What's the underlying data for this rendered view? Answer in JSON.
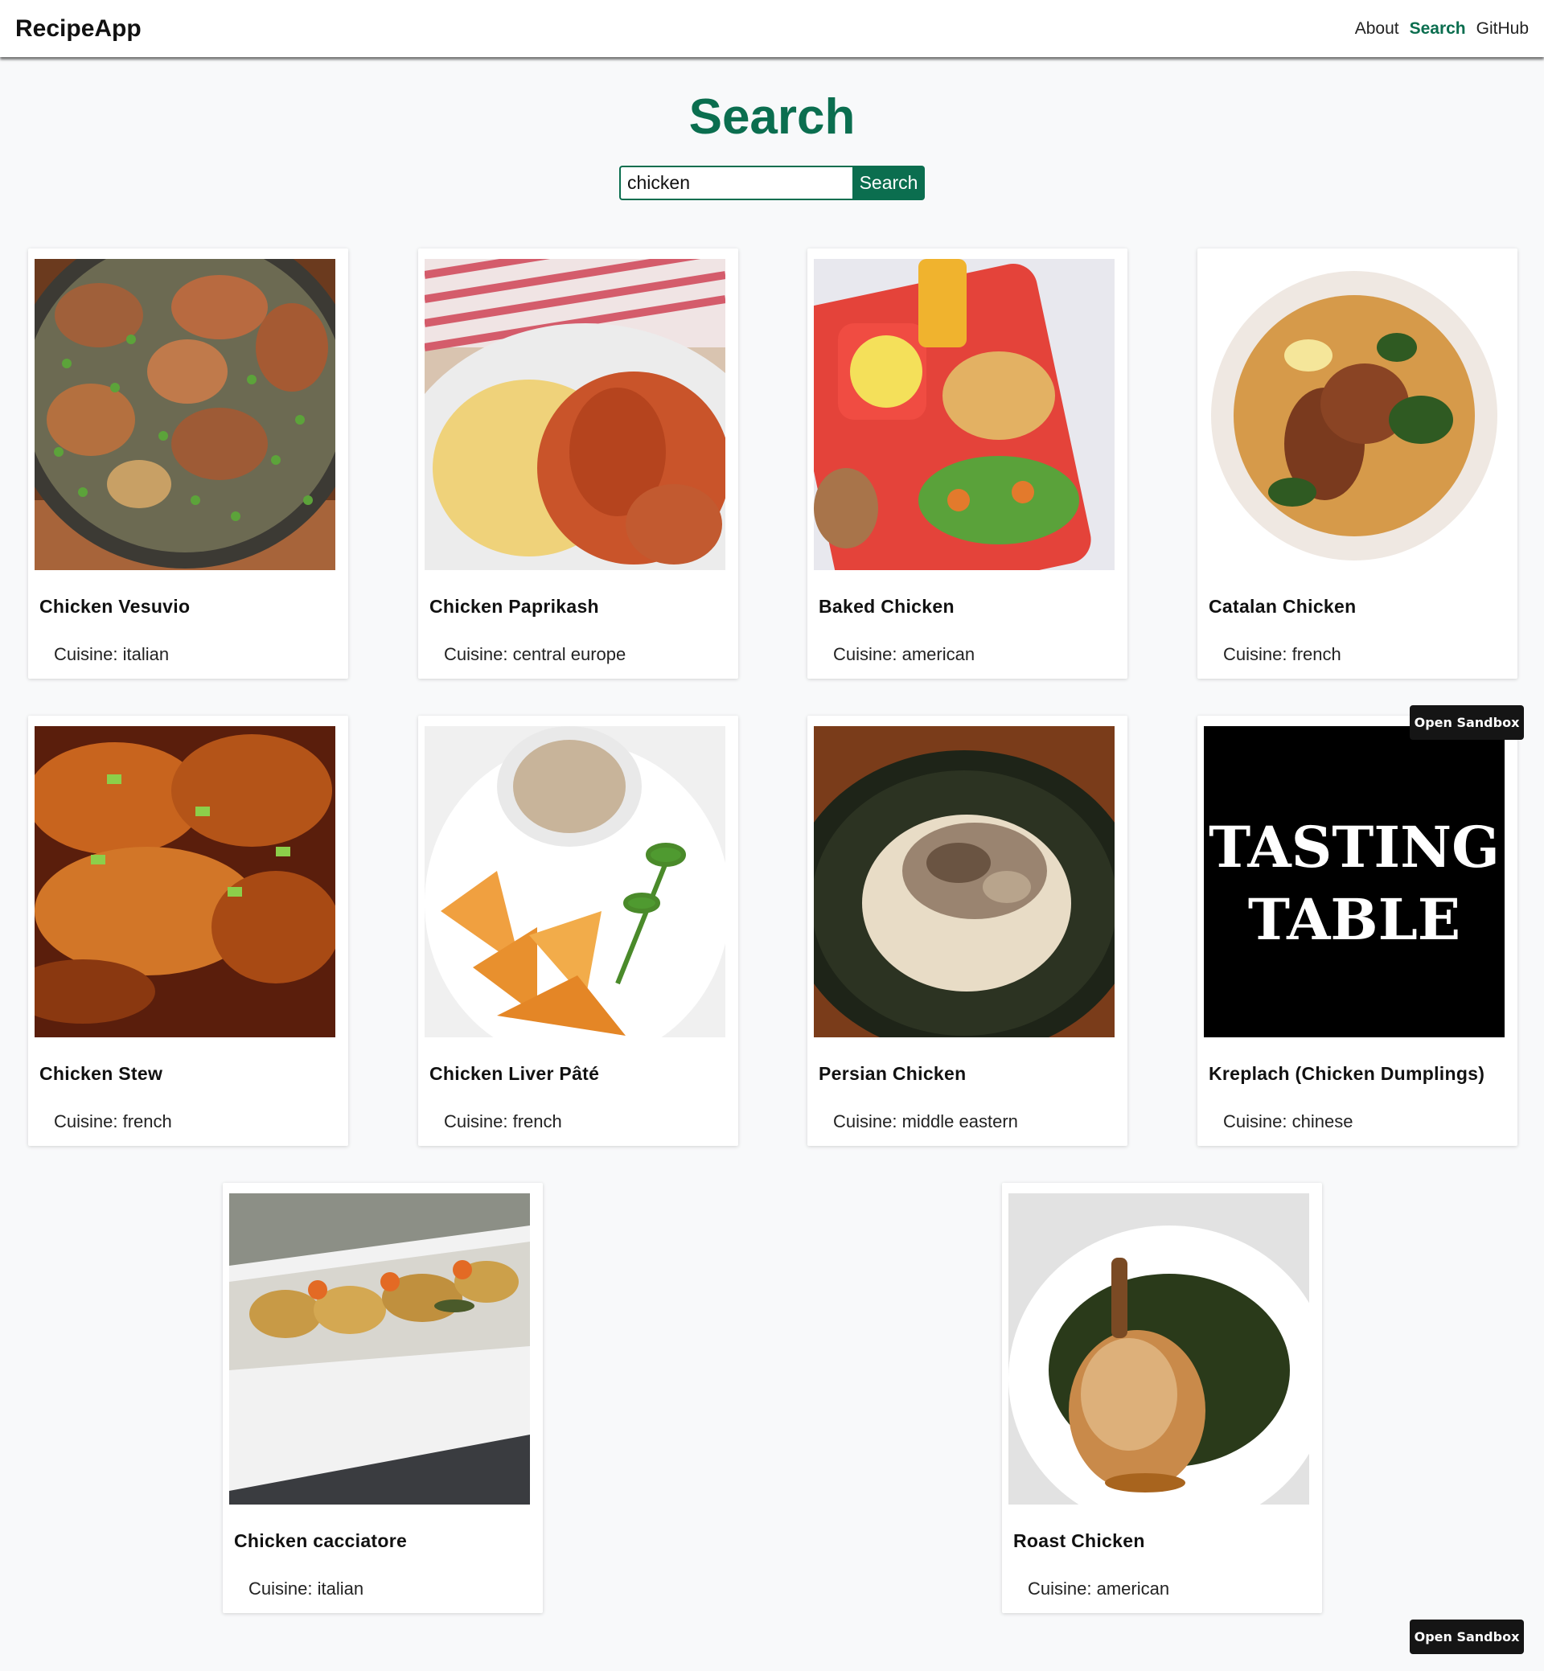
{
  "navbar": {
    "brand": "RecipeApp",
    "links": [
      {
        "label": "About",
        "active": false
      },
      {
        "label": "Search",
        "active": true
      },
      {
        "label": "GitHub",
        "active": false
      }
    ]
  },
  "page": {
    "title": "Search"
  },
  "search": {
    "value": "chicken",
    "button_label": "Search"
  },
  "recipes": [
    {
      "title": "Chicken Vesuvio",
      "cuisine": "Cuisine: italian"
    },
    {
      "title": "Chicken Paprikash",
      "cuisine": "Cuisine: central europe"
    },
    {
      "title": "Baked Chicken",
      "cuisine": "Cuisine: american"
    },
    {
      "title": "Catalan Chicken",
      "cuisine": "Cuisine: french"
    },
    {
      "title": "Chicken Stew",
      "cuisine": "Cuisine: french"
    },
    {
      "title": "Chicken Liver Pâté",
      "cuisine": "Cuisine: french"
    },
    {
      "title": "Persian Chicken",
      "cuisine": "Cuisine: middle eastern"
    },
    {
      "title": "Kreplach (Chicken Dumplings)",
      "cuisine": "Cuisine: chinese",
      "logo_text": [
        "TASTING",
        "TABLE"
      ]
    },
    {
      "title": "Chicken cacciatore",
      "cuisine": "Cuisine: italian"
    },
    {
      "title": "Roast Chicken",
      "cuisine": "Cuisine: american"
    }
  ],
  "sandbox_buttons": [
    "Open Sandbox",
    "Open Sandbox"
  ],
  "colors": {
    "accent": "#0b6e4f",
    "background": "#f8f9fa",
    "sandbox": "#151515"
  }
}
